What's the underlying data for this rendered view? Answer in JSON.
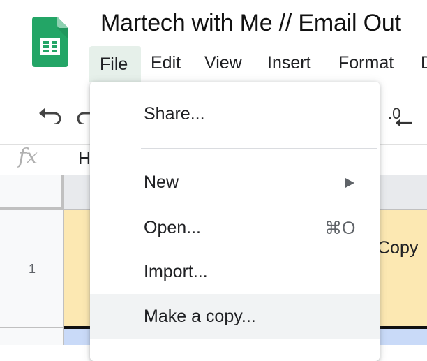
{
  "app": {
    "doc_title": "Martech with Me // Email Out"
  },
  "menubar": {
    "items": [
      {
        "label": "File"
      },
      {
        "label": "Edit"
      },
      {
        "label": "View"
      },
      {
        "label": "Insert"
      },
      {
        "label": "Format"
      },
      {
        "label": "D"
      }
    ]
  },
  "toolbar": {
    "decrease_decimal_label": ".0"
  },
  "formula_bar": {
    "fx_symbol": "fx",
    "value": "H"
  },
  "grid": {
    "row_number": "1",
    "visible_cell_text": "Copy"
  },
  "file_menu": {
    "share": "Share...",
    "new": "New",
    "open": "Open...",
    "open_shortcut": "⌘O",
    "import": "Import...",
    "make_copy": "Make a copy..."
  },
  "colors": {
    "logo_green": "#23a566",
    "active_menu_bg": "#e6f0ea",
    "cell_highlight": "#fce8b2",
    "row2_fill": "#c9daf8",
    "hover_bg": "#f1f3f4"
  }
}
